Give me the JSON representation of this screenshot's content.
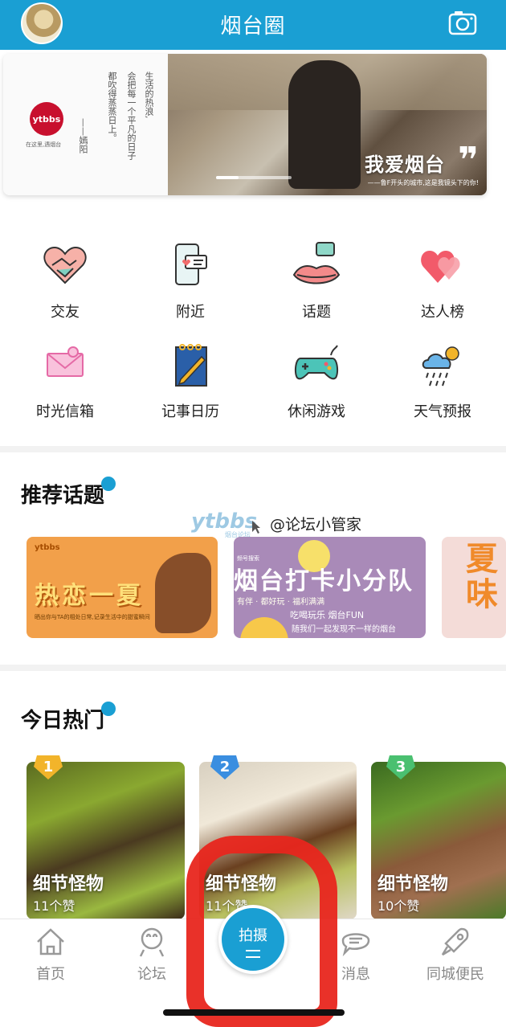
{
  "header": {
    "title": "烟台圈",
    "avatar_icon": "user-avatar",
    "camera_icon": "camera-icon",
    "accent": "#1a9fd3"
  },
  "banner": {
    "logo_text": "ytbbs",
    "slogan": "在这里,遇烟台",
    "poem_lines": [
      "生活的热浪,",
      "会把每一个平凡的日子",
      "都吹得蒸蒸日上。"
    ],
    "poem_author": "——嫣阳",
    "headline": "我爱烟台",
    "sub": "——鲁F开头的城市,这是我镜头下的你!"
  },
  "grid": [
    {
      "label": "交友",
      "icon": "handshake-heart-icon"
    },
    {
      "label": "附近",
      "icon": "phone-message-icon"
    },
    {
      "label": "话题",
      "icon": "lips-chat-icon"
    },
    {
      "label": "达人榜",
      "icon": "hearts-icon"
    },
    {
      "label": "时光信箱",
      "icon": "envelope-icon"
    },
    {
      "label": "记事日历",
      "icon": "notebook-pen-icon"
    },
    {
      "label": "休闲游戏",
      "icon": "gamepad-icon"
    },
    {
      "label": "天气预报",
      "icon": "weather-cloud-icon"
    }
  ],
  "recommend": {
    "title": "推荐话题",
    "watermark": "ytbbs",
    "watermark_sub": "烟台论坛",
    "mention": "@论坛小管家",
    "topics": [
      {
        "logo": "ytbbs",
        "big": "热恋一夏",
        "small": "晒出你与TA的相处日常,记录生活中的甜蜜瞬间"
      },
      {
        "tag": "频号搜索",
        "big": "烟台打卡小分队",
        "line1": "有伴 · 都好玩 · 福利满满",
        "line2": "吃喝玩乐  烟台FUN",
        "line3": "随我们一起发现不一样的烟台"
      },
      {
        "big": "夏味"
      }
    ]
  },
  "hot": {
    "title": "今日热门",
    "items": [
      {
        "rank": "1",
        "name": "细节怪物",
        "likes": "11个赞",
        "rank_color": "#f2b42a"
      },
      {
        "rank": "2",
        "name": "细节怪物",
        "likes": "11个赞",
        "rank_color": "#3a8ee0"
      },
      {
        "rank": "3",
        "name": "细节怪物",
        "likes": "10个赞",
        "rank_color": "#4ac070"
      }
    ]
  },
  "tabbar": {
    "items": [
      {
        "label": "首页",
        "icon": "home-icon"
      },
      {
        "label": "论坛",
        "icon": "forum-icon"
      },
      {
        "label": "消息",
        "icon": "message-icon"
      },
      {
        "label": "同城便民",
        "icon": "rocket-icon"
      }
    ],
    "shoot_label": "拍摄"
  }
}
